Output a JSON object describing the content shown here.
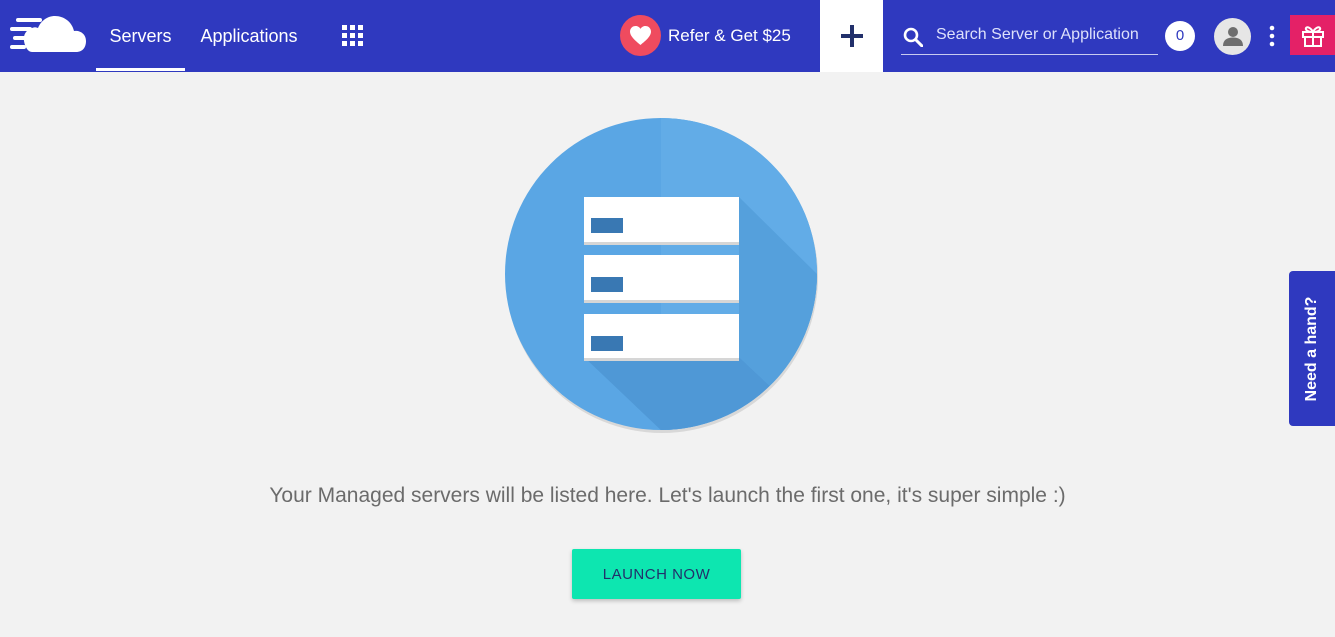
{
  "header": {
    "nav": [
      {
        "label": "Servers",
        "active": true
      },
      {
        "label": "Applications",
        "active": false
      }
    ],
    "apps_icon": "grid-icon",
    "refer_label": "Refer & Get $25",
    "add_icon": "plus-icon",
    "search_placeholder": "Search Server or Application",
    "search_value": "",
    "notification_count": "0",
    "accent_color": "#2f39bf",
    "gift_color": "#e42167"
  },
  "main": {
    "empty_message": "Your Managed servers will be listed here. Let's launch the first one, it's super simple :)",
    "launch_label": "LAUNCH NOW",
    "launch_color": "#0de6b0"
  },
  "help": {
    "label": "Need a hand?"
  }
}
